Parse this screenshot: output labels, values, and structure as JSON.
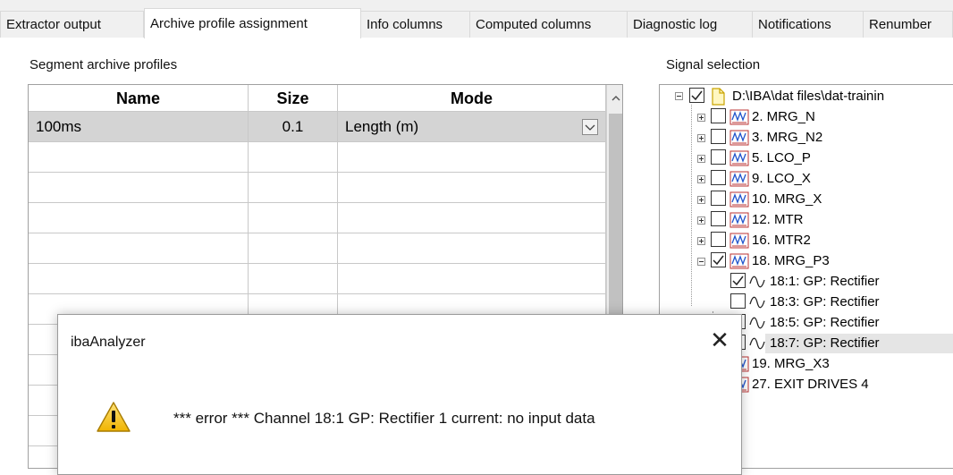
{
  "tabs": [
    {
      "label": "Extractor output"
    },
    {
      "label": "Archive profile assignment"
    },
    {
      "label": "Info columns"
    },
    {
      "label": "Computed columns"
    },
    {
      "label": "Diagnostic log"
    },
    {
      "label": "Notifications"
    },
    {
      "label": "Renumber"
    }
  ],
  "segment_profiles": {
    "label": "Segment archive profiles",
    "columns": [
      "Name",
      "Size",
      "Mode"
    ],
    "rows": [
      {
        "name": "100ms",
        "size": "0.1",
        "mode": "Length (m)"
      }
    ]
  },
  "signal_selection": {
    "label": "Signal selection",
    "root": "D:\\IBA\\dat files\\dat-trainin",
    "items": [
      {
        "label": "2. MRG_N"
      },
      {
        "label": "3. MRG_N2"
      },
      {
        "label": "5. LCO_P"
      },
      {
        "label": "9. LCO_X"
      },
      {
        "label": "10. MRG_X"
      },
      {
        "label": "12. MTR"
      },
      {
        "label": "16. MTR2"
      },
      {
        "label": "18. MRG_P3"
      },
      {
        "label": "18:1: GP: Rectifier"
      },
      {
        "label": "18:3: GP: Rectifier"
      },
      {
        "label": "18:5: GP: Rectifier"
      },
      {
        "label": "18:7: GP: Rectifier"
      },
      {
        "label": "19. MRG_X3"
      },
      {
        "label": "27. EXIT DRIVES 4"
      }
    ]
  },
  "dialog": {
    "title": "ibaAnalyzer",
    "message": "*** error *** Channel 18:1 GP: Rectifier 1 current: no input data",
    "close_glyph": "✕"
  }
}
